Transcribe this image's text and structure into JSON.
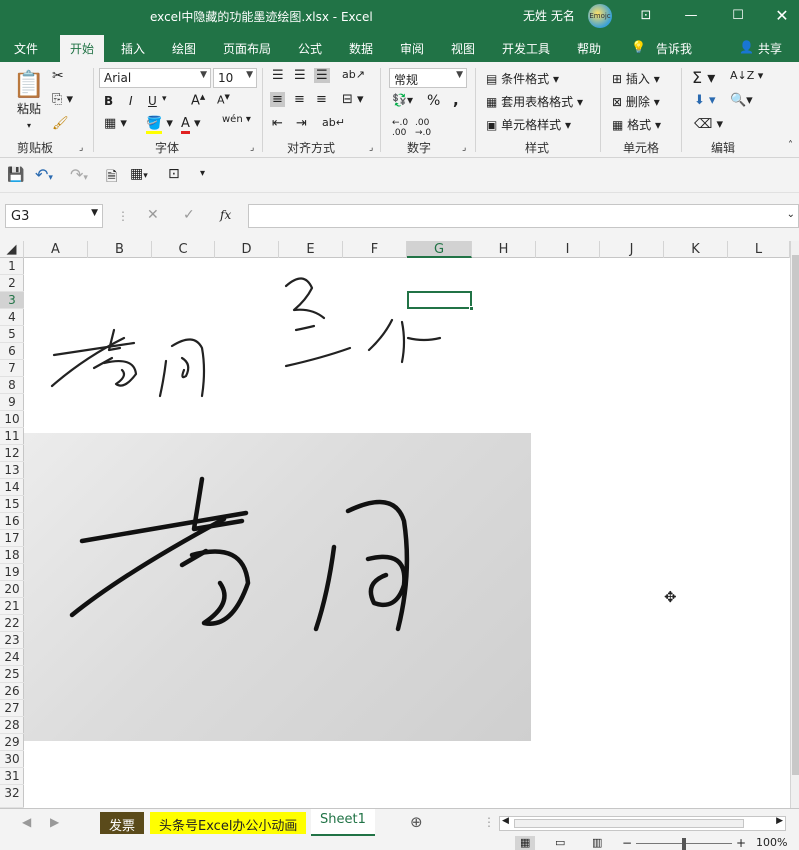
{
  "window": {
    "title": "excel中隐藏的功能墨迹绘图.xlsx - Excel",
    "user": "无姓 无名",
    "avatar_text": "Emojc"
  },
  "tabs": [
    "文件",
    "开始",
    "插入",
    "绘图",
    "页面布局",
    "公式",
    "数据",
    "审阅",
    "视图",
    "开发工具",
    "帮助",
    "告诉我",
    "共享"
  ],
  "ribbon": {
    "paste_label": "粘贴",
    "groups": [
      "剪贴板",
      "字体",
      "对齐方式",
      "数字",
      "样式",
      "单元格",
      "编辑"
    ],
    "font_name": "Arial",
    "font_size": "10",
    "number_format": "常规",
    "bold": "B",
    "italic": "I",
    "underline": "U",
    "conditional_format": "条件格式",
    "table_format": "套用表格格式",
    "cell_style": "单元格样式",
    "insert": "插入",
    "delete": "删除",
    "format": "格式",
    "percent": "%",
    "comma": ","
  },
  "formula_bar": {
    "name_box": "G3",
    "fx_label": "fx",
    "formula": ""
  },
  "columns": [
    "A",
    "B",
    "C",
    "D",
    "E",
    "F",
    "G",
    "H",
    "I",
    "J",
    "K",
    "L"
  ],
  "selected_column": "G",
  "rows": [
    "1",
    "2",
    "3",
    "4",
    "5",
    "6",
    "7",
    "8",
    "9",
    "10",
    "11",
    "12",
    "13",
    "14",
    "15",
    "16",
    "17",
    "18",
    "19",
    "20",
    "21",
    "22",
    "23",
    "24",
    "25",
    "26",
    "27",
    "28",
    "29",
    "30",
    "31",
    "32"
  ],
  "selected_row": "3",
  "sheets": [
    "发票",
    "头条号Excel办公小动画",
    "Sheet1"
  ],
  "active_sheet": "Sheet1",
  "status": {
    "zoom": "100%"
  },
  "colors": {
    "excel_green": "#217346",
    "tab_fapiao": "#5a4a1a",
    "tab_yellow": "#ffff00"
  }
}
